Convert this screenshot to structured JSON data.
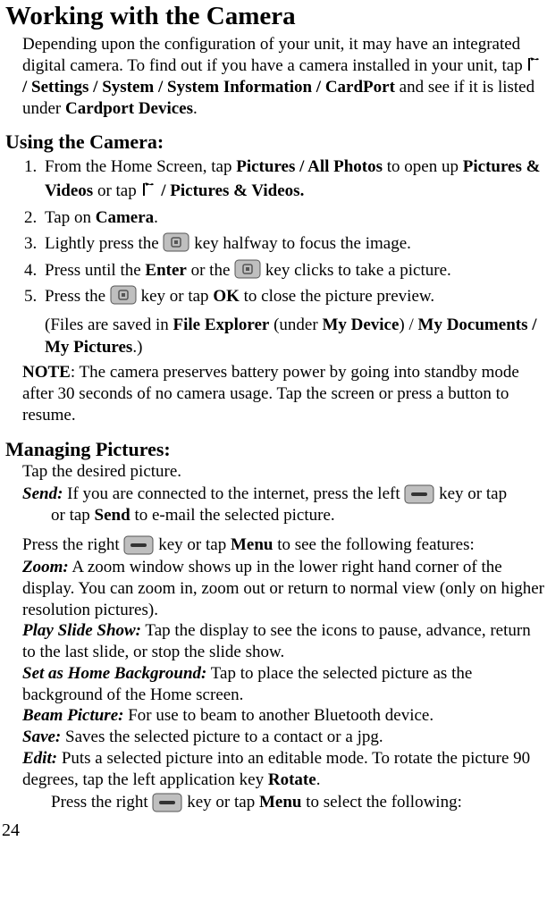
{
  "page": {
    "title": "Working with the Camera",
    "intro_pre": "Depending upon the configuration of your unit, it may have an integrated digital camera. To find out if you have a camera installed in your unit, tap ",
    "intro_path": "/ Settings / System / System Information / CardPort",
    "intro_mid": " and see if it is listed under ",
    "intro_end_bold": "Cardport Devices",
    "intro_period": ".",
    "number": "24"
  },
  "using": {
    "heading": "Using the Camera:",
    "step1_pre": "From the Home Screen, tap ",
    "step1_b1": "Pictures / All Photos",
    "step1_mid": " to open up ",
    "step1_b2": "Pictures & Videos",
    "step1_or": " or tap ",
    "step1_b3": "/ Pictures & Videos.",
    "step2_pre": "Tap on ",
    "step2_b": "Camera",
    "step2_post": ".",
    "step3_pre": "Lightly press the ",
    "step3_post": " key halfway to focus the image.",
    "step4_pre": "Press until the ",
    "step4_b": "Enter",
    "step4_mid": " or the ",
    "step4_post": " key clicks to take a picture.",
    "step5_pre": "Press the ",
    "step5_mid": " key or tap ",
    "step5_b": "OK",
    "step5_post": " to close the picture preview.",
    "step5_parens_pre": "(Files are saved in ",
    "step5_parens_b1": "File Explorer",
    "step5_parens_mid1": " (under ",
    "step5_parens_b2": "My Device",
    "step5_parens_mid2": ") / ",
    "step5_parens_b3": "My Documents / My Pictures",
    "step5_parens_post": ".)",
    "note_b": "NOTE",
    "note_text": ": The camera preserves battery power by going into standby mode after 30 seconds of no camera usage. Tap the screen or press a button to resume."
  },
  "managing": {
    "heading": "Managing Pictures:",
    "tap_line": "Tap the desired picture.",
    "send_b": "Send:",
    "send_pre": " If you are connected to the internet, press the left ",
    "send_mid": " key or tap ",
    "send_b2": "Send",
    "send_post": " to e-mail the selected picture.",
    "menu_pre": "Press the right ",
    "menu_mid": " key or tap ",
    "menu_b": "Menu",
    "menu_post": " to see the following features:",
    "zoom_b": "Zoom:",
    "zoom_text": " A zoom window shows up in the lower right hand corner of the display. You can zoom in, zoom out or return to normal view (only on higher resolution pictures).",
    "play_b": "Play Slide Show:",
    "play_text": " Tap the display to see the icons to pause, advance, return to the last slide, or stop the slide show.",
    "sethome_b": "Set as Home Background:",
    "sethome_text": " Tap to place the selected picture as the background of the Home screen.",
    "beam_b": "Beam Picture:",
    "beam_text": " For use to beam to another Bluetooth device.",
    "save_b": "Save:",
    "save_text": " Saves the selected picture to a contact or a jpg.",
    "edit_b": "Edit:",
    "edit_text": " Puts a selected picture into an editable mode. To rotate the picture 90 degrees, tap the left application key ",
    "edit_b2": "Rotate",
    "edit_post": ".",
    "edit2_pre": "Press the right ",
    "edit2_mid": " key or tap ",
    "edit2_b": "Menu",
    "edit2_post": " to select the following:"
  }
}
